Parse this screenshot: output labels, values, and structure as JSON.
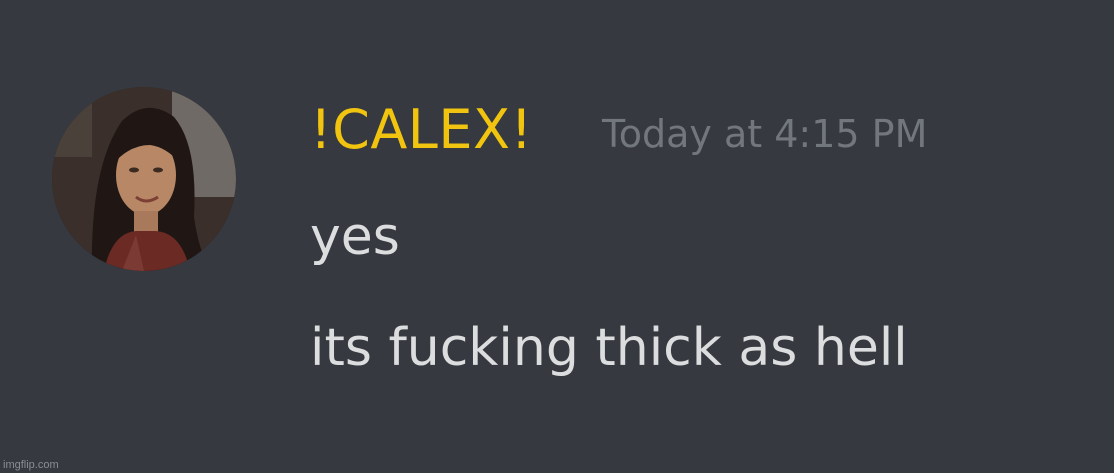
{
  "message": {
    "author": "!CALEX!",
    "timestamp": "Today at 4:15 PM",
    "lines": [
      "yes",
      "its fucking thick as hell"
    ],
    "author_color": "#f1c40f",
    "timestamp_color": "#72767d",
    "text_color": "#dcddde"
  },
  "watermark": "imgflip.com",
  "theme": {
    "background": "#36393f"
  }
}
